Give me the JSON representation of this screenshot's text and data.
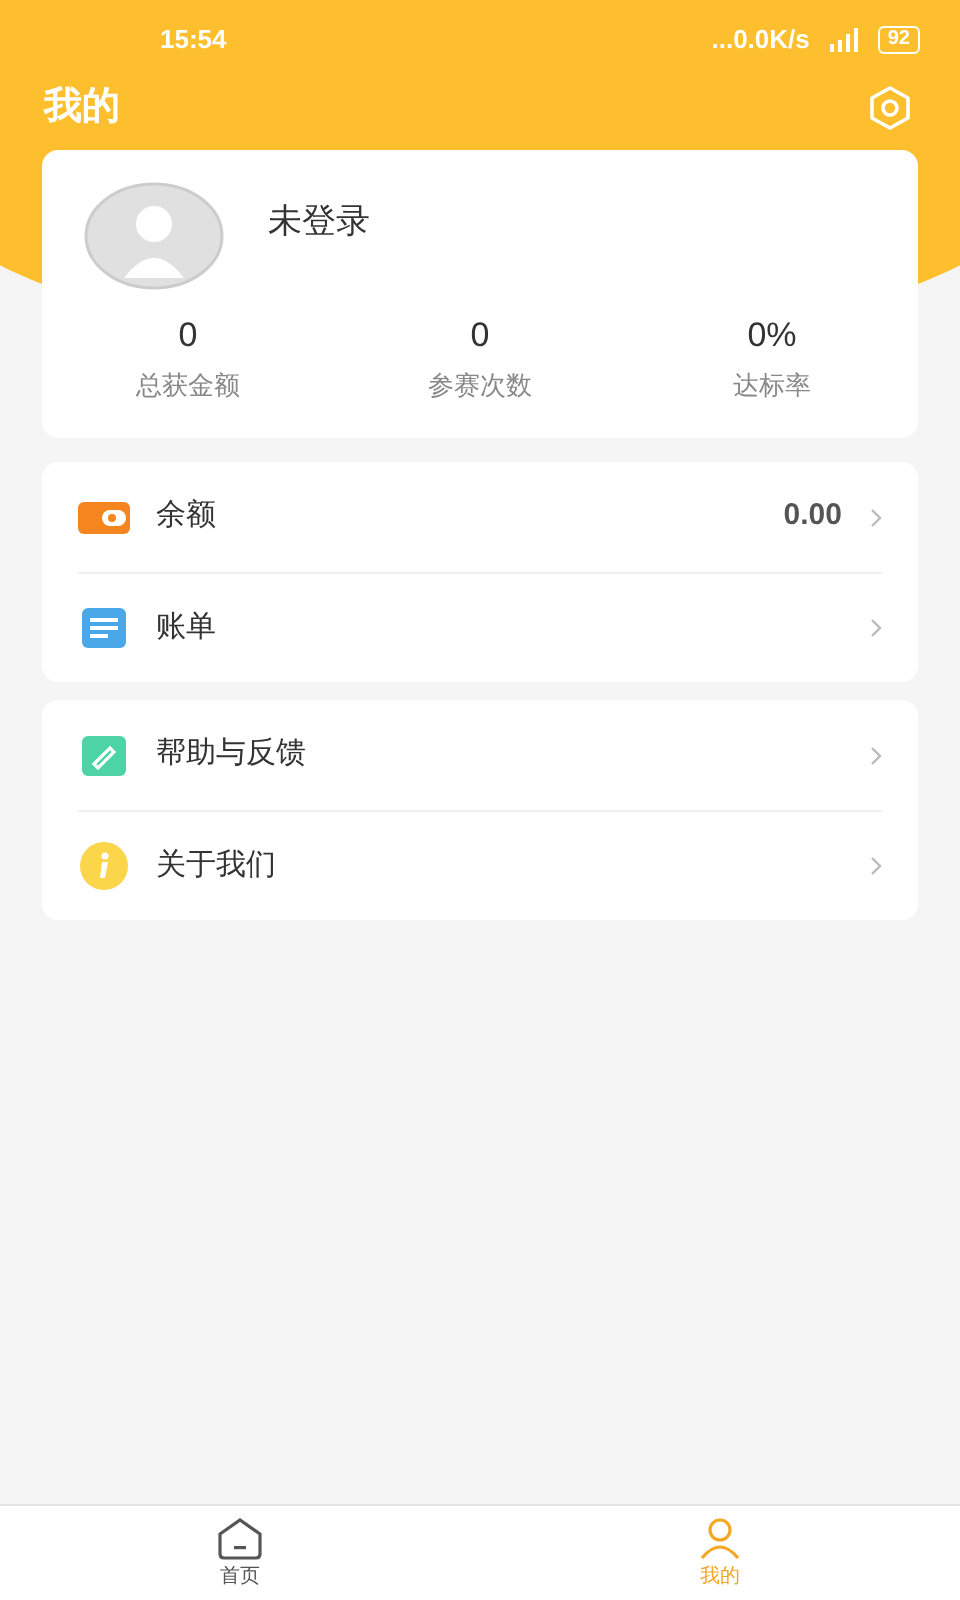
{
  "status_bar": {
    "time": "15:54",
    "speed": "...0.0K/s",
    "battery": "92"
  },
  "header": {
    "title": "我的"
  },
  "profile": {
    "name": "未登录",
    "stats": [
      {
        "value": "0",
        "label": "总获金额"
      },
      {
        "value": "0",
        "label": "参赛次数"
      },
      {
        "value": "0%",
        "label": "达标率"
      }
    ]
  },
  "menu_groups": [
    [
      {
        "kind": "wallet",
        "label": "余额",
        "value": "0.00"
      },
      {
        "kind": "bill",
        "label": "账单"
      }
    ],
    [
      {
        "kind": "feedback",
        "label": "帮助与反馈"
      },
      {
        "kind": "about",
        "label": "关于我们"
      }
    ]
  ],
  "bottom_nav": [
    {
      "kind": "home",
      "label": "首页",
      "selected": false
    },
    {
      "kind": "mine",
      "label": "我的",
      "selected": true
    }
  ]
}
